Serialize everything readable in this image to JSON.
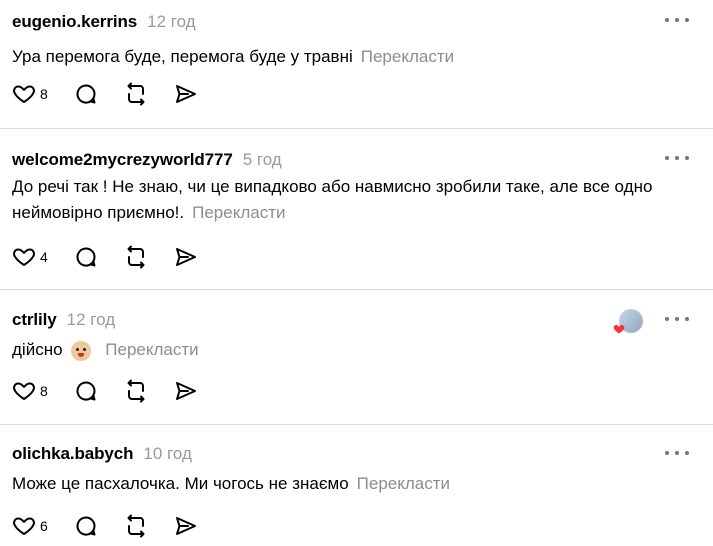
{
  "comments": [
    {
      "user": "eugenio.kerrins",
      "time": "12 год",
      "text": "Ура перемога буде, перемога буде у травні",
      "translate": "Перекласти",
      "likes": "8"
    },
    {
      "user": "welcome2mycrezyworld777",
      "time": "5 год",
      "text": "До речі так ! Не знаю, чи це випадково або навмисно зробили таке, але все одно неймовірно приємно!.",
      "translate": "Перекласти",
      "likes": "4"
    },
    {
      "user": "ctrlily",
      "time": "12 год",
      "text": "дійсно",
      "translate": "Перекласти",
      "likes": "8",
      "emoji": "surprised-face-emoji"
    },
    {
      "user": "olichka.babych",
      "time": "10 год",
      "text": "Може це пасхалочка. Ми чогось не знаємо",
      "translate": "Перекласти",
      "likes": "6"
    }
  ],
  "colors": {
    "muted": "#9a9a9a",
    "divider": "#dbdbdb",
    "heart": "#ff3040"
  },
  "icons": [
    "heart-icon",
    "comment-icon",
    "repost-icon",
    "share-icon",
    "more-icon"
  ]
}
